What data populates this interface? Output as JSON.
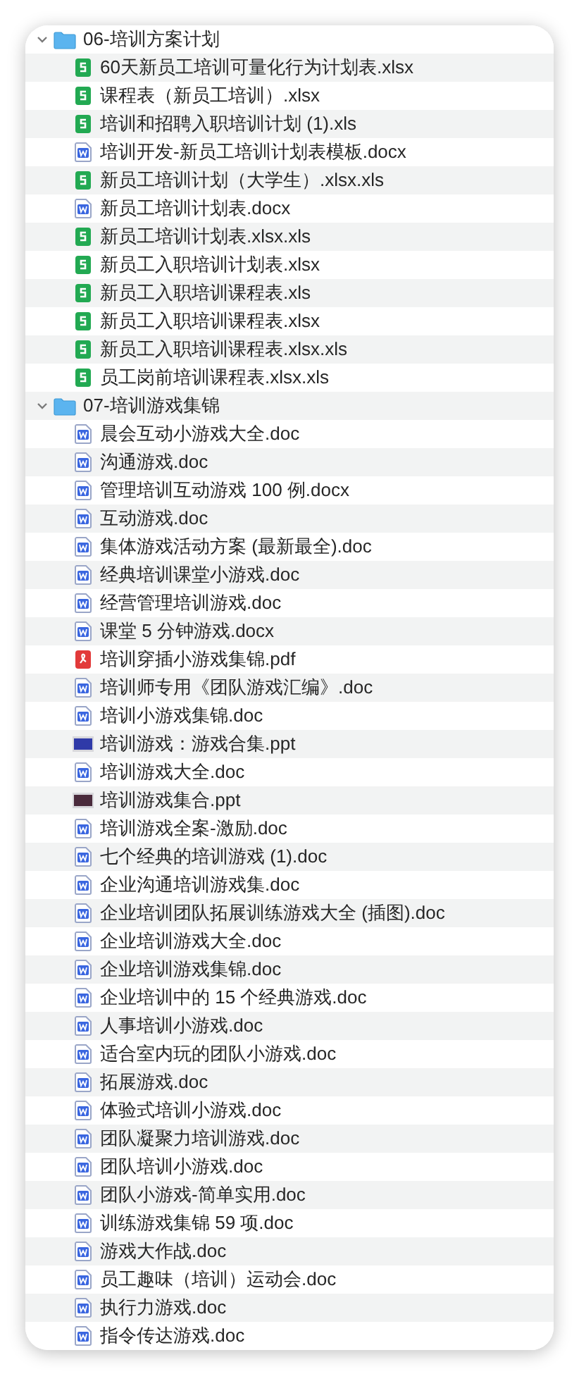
{
  "folders": [
    {
      "name": "06-培训方案计划",
      "expanded": true,
      "files": [
        {
          "name": "60天新员工培训可量化行为计划表.xlsx",
          "kind": "sheet"
        },
        {
          "name": "课程表（新员工培训）.xlsx",
          "kind": "sheet"
        },
        {
          "name": "培训和招聘入职培训计划 (1).xls",
          "kind": "sheet"
        },
        {
          "name": "培训开发-新员工培训计划表模板.docx",
          "kind": "doc"
        },
        {
          "name": "新员工培训计划（大学生）.xlsx.xls",
          "kind": "sheet"
        },
        {
          "name": "新员工培训计划表.docx",
          "kind": "doc"
        },
        {
          "name": "新员工培训计划表.xlsx.xls",
          "kind": "sheet"
        },
        {
          "name": "新员工入职培训计划表.xlsx",
          "kind": "sheet"
        },
        {
          "name": "新员工入职培训课程表.xls",
          "kind": "sheet"
        },
        {
          "name": "新员工入职培训课程表.xlsx",
          "kind": "sheet"
        },
        {
          "name": "新员工入职培训课程表.xlsx.xls",
          "kind": "sheet"
        },
        {
          "name": "员工岗前培训课程表.xlsx.xls",
          "kind": "sheet"
        }
      ]
    },
    {
      "name": "07-培训游戏集锦",
      "expanded": true,
      "files": [
        {
          "name": "晨会互动小游戏大全.doc",
          "kind": "doc"
        },
        {
          "name": "沟通游戏.doc",
          "kind": "doc"
        },
        {
          "name": "管理培训互动游戏 100 例.docx",
          "kind": "doc"
        },
        {
          "name": "互动游戏.doc",
          "kind": "doc"
        },
        {
          "name": "集体游戏活动方案 (最新最全).doc",
          "kind": "doc"
        },
        {
          "name": "经典培训课堂小游戏.doc",
          "kind": "doc"
        },
        {
          "name": "经营管理培训游戏.doc",
          "kind": "doc"
        },
        {
          "name": "课堂 5 分钟游戏.docx",
          "kind": "doc"
        },
        {
          "name": "培训穿插小游戏集锦.pdf",
          "kind": "pdf"
        },
        {
          "name": "培训师专用《团队游戏汇编》.doc",
          "kind": "doc"
        },
        {
          "name": "培训小游戏集锦.doc",
          "kind": "doc"
        },
        {
          "name": "培训游戏：游戏合集.ppt",
          "kind": "slides",
          "color": "#2f3aa8"
        },
        {
          "name": "培训游戏大全.doc",
          "kind": "doc"
        },
        {
          "name": "培训游戏集合.ppt",
          "kind": "slides",
          "color": "#4a2b3c"
        },
        {
          "name": "培训游戏全案-激励.doc",
          "kind": "doc"
        },
        {
          "name": "七个经典的培训游戏 (1).doc",
          "kind": "doc"
        },
        {
          "name": "企业沟通培训游戏集.doc",
          "kind": "doc"
        },
        {
          "name": "企业培训团队拓展训练游戏大全 (插图).doc",
          "kind": "doc"
        },
        {
          "name": "企业培训游戏大全.doc",
          "kind": "doc"
        },
        {
          "name": "企业培训游戏集锦.doc",
          "kind": "doc"
        },
        {
          "name": "企业培训中的 15 个经典游戏.doc",
          "kind": "doc"
        },
        {
          "name": "人事培训小游戏.doc",
          "kind": "doc"
        },
        {
          "name": "适合室内玩的团队小游戏.doc",
          "kind": "doc"
        },
        {
          "name": "拓展游戏.doc",
          "kind": "doc"
        },
        {
          "name": "体验式培训小游戏.doc",
          "kind": "doc"
        },
        {
          "name": "团队凝聚力培训游戏.doc",
          "kind": "doc"
        },
        {
          "name": "团队培训小游戏.doc",
          "kind": "doc"
        },
        {
          "name": "团队小游戏-简单实用.doc",
          "kind": "doc"
        },
        {
          "name": "训练游戏集锦 59 项.doc",
          "kind": "doc"
        },
        {
          "name": "游戏大作战.doc",
          "kind": "doc"
        },
        {
          "name": "员工趣味（培训）运动会.doc",
          "kind": "doc"
        },
        {
          "name": "执行力游戏.doc",
          "kind": "doc"
        },
        {
          "name": "指令传达游戏.doc",
          "kind": "doc"
        }
      ]
    }
  ]
}
